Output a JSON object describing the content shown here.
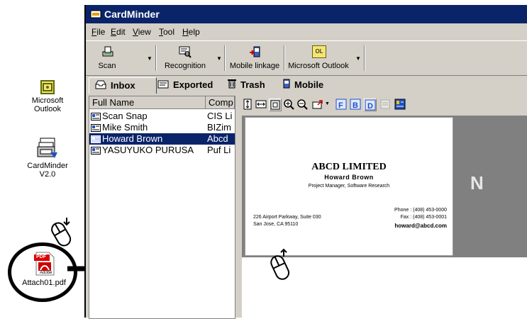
{
  "desktop": {
    "outlook_label": "Microsoft Outlook",
    "cardminder_label_1": "CardMinder",
    "cardminder_label_2": "V2.0",
    "pdf_label": "Attach01.pdf",
    "pdf_badge": "PDF",
    "pdf_brand": "Adobe"
  },
  "window": {
    "title": "CardMinder",
    "menu": [
      "File",
      "Edit",
      "View",
      "Tool",
      "Help"
    ]
  },
  "toolbar": {
    "scan": "Scan",
    "recognition": "Recognition",
    "mobile_linkage": "Mobile linkage",
    "outlook": "Microsoft Outlook",
    "outlook_icon_text": "OL"
  },
  "tabs": {
    "inbox": "Inbox",
    "exported": "Exported",
    "trash": "Trash",
    "mobile": "Mobile"
  },
  "list": {
    "col_name": "Full Name",
    "col_company": "Comp",
    "rows": [
      {
        "name": "Scan Snap",
        "company": "CIS Li"
      },
      {
        "name": "Mike Smith",
        "company": "BIZim"
      },
      {
        "name": "Howard Brown",
        "company": "Abcd"
      },
      {
        "name": "YASUYUKO PURUSA",
        "company": "Puf Li"
      }
    ],
    "selected_index": 2
  },
  "card": {
    "company": "ABCD LIMITED",
    "person": "Howard Brown",
    "title": "Project Manager, Software Research",
    "address_1": "226 Airport Parkway, Suite 030",
    "address_2": "San Jose, CA 95110",
    "phone": "Phone : (408) 453-0000",
    "fax": "Fax : (408) 453-0001",
    "email": "howard@abcd.com"
  },
  "preview": {
    "side_letter": "N"
  },
  "colors": {
    "titlebar": "#0a246a",
    "selection": "#0a246a",
    "chrome": "#d4d0c8"
  }
}
